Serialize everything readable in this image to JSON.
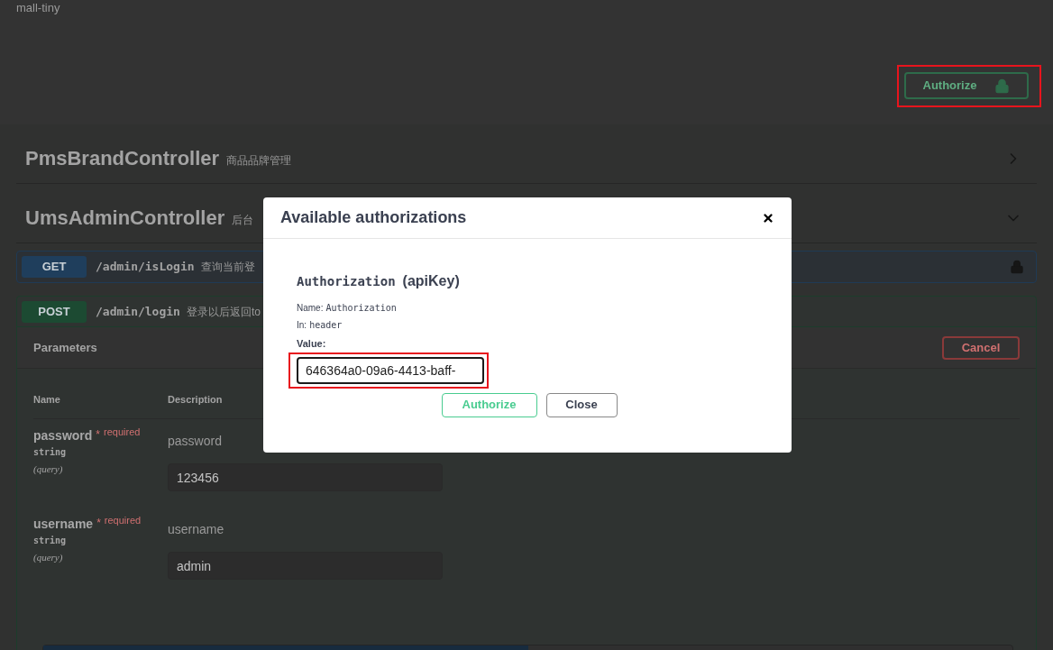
{
  "header": {
    "title": "mall-tiny",
    "authorize_button": "Authorize"
  },
  "controllers": [
    {
      "name": "PmsBrandController",
      "description": "商品品牌管理",
      "expanded": false
    },
    {
      "name": "UmsAdminController",
      "description": "后台",
      "expanded": true
    }
  ],
  "operations": [
    {
      "method": "GET",
      "path": "/admin/isLogin",
      "summary": "查询当前登",
      "color": "#1f3e5c",
      "expanded": false
    },
    {
      "method": "POST",
      "path": "/admin/login",
      "summary": "登录以后返回to",
      "color": "#1c4a32",
      "expanded": true
    }
  ],
  "parameters_panel": {
    "title": "Parameters",
    "cancel_button": "Cancel",
    "columns": [
      "Name",
      "Description"
    ],
    "rows": [
      {
        "name": "password",
        "required_mark": "*",
        "required_label": "required",
        "type": "string",
        "location": "(query)",
        "description": "password",
        "value": "123456"
      },
      {
        "name": "username",
        "required_mark": "*",
        "required_label": "required",
        "type": "string",
        "location": "(query)",
        "description": "username",
        "value": "admin"
      }
    ]
  },
  "dialog": {
    "title": "Available authorizations",
    "scheme_title": "Authorization",
    "scheme_type": "(apiKey)",
    "name_label": "Name:",
    "name_value": "Authorization",
    "in_label": "In:",
    "in_value": "header",
    "value_label": "Value:",
    "value": "646364a0-09a6-4413-baff-",
    "buttons": [
      {
        "label": "Authorize",
        "kind": "primary"
      },
      {
        "label": "Close",
        "kind": "secondary"
      }
    ]
  }
}
